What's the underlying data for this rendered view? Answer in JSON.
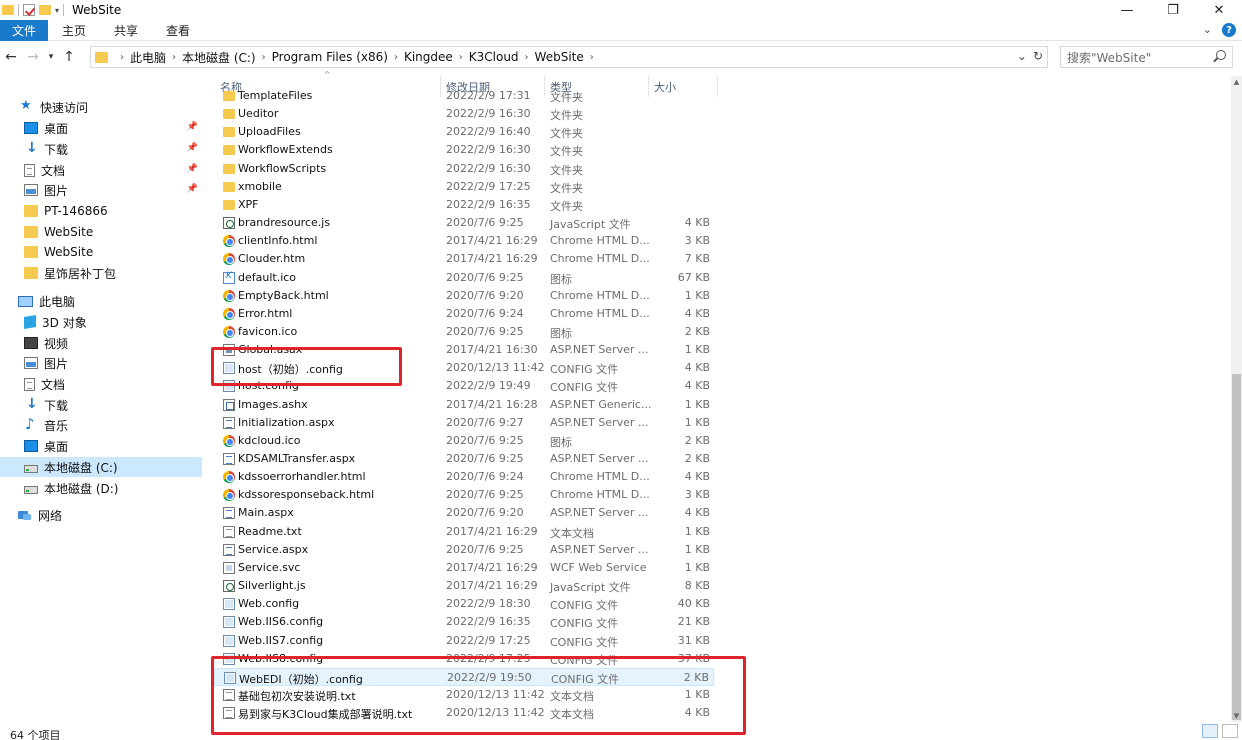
{
  "window": {
    "title": "WebSite",
    "minimize": "—",
    "maximize": "❐",
    "close": "✕"
  },
  "ribbon": {
    "tabs": [
      "文件",
      "主页",
      "共享",
      "查看"
    ],
    "expand": "⌄",
    "help": "?"
  },
  "address": {
    "crumbs": [
      "此电脑",
      "本地磁盘 (C:)",
      "Program Files (x86)",
      "Kingdee",
      "K3Cloud",
      "WebSite"
    ],
    "search_placeholder": "搜索\"WebSite\""
  },
  "sidebar": {
    "items": [
      {
        "label": "快速访问",
        "icon": "star-icon",
        "pinned": false
      },
      {
        "label": "桌面",
        "icon": "desktop-icon",
        "pinned": true
      },
      {
        "label": "下载",
        "icon": "download-icon",
        "pinned": true
      },
      {
        "label": "文档",
        "icon": "document-icon",
        "pinned": true
      },
      {
        "label": "图片",
        "icon": "picture-icon",
        "pinned": true
      },
      {
        "label": "PT-146866",
        "icon": "folder-icon",
        "pinned": false
      },
      {
        "label": "WebSite",
        "icon": "folder-icon",
        "pinned": false
      },
      {
        "label": "WebSite",
        "icon": "folder-icon",
        "pinned": false
      },
      {
        "label": "星饰居补丁包",
        "icon": "folder-icon",
        "pinned": false
      },
      {
        "label": "此电脑",
        "icon": "computer-icon",
        "pinned": false
      },
      {
        "label": "3D 对象",
        "icon": "3d-objects-icon",
        "pinned": false
      },
      {
        "label": "视频",
        "icon": "video-icon",
        "pinned": false
      },
      {
        "label": "图片",
        "icon": "picture-icon",
        "pinned": false
      },
      {
        "label": "文档",
        "icon": "document-icon",
        "pinned": false
      },
      {
        "label": "下载",
        "icon": "download-icon",
        "pinned": false
      },
      {
        "label": "音乐",
        "icon": "music-icon",
        "pinned": false
      },
      {
        "label": "桌面",
        "icon": "desktop-icon",
        "pinned": false
      },
      {
        "label": "本地磁盘 (C:)",
        "icon": "drive-icon",
        "pinned": false,
        "selected": true
      },
      {
        "label": "本地磁盘 (D:)",
        "icon": "drive-icon",
        "pinned": false
      },
      {
        "label": "网络",
        "icon": "network-icon",
        "pinned": false
      }
    ]
  },
  "columns": {
    "name": "名称",
    "date": "修改日期",
    "type": "类型",
    "size": "大小"
  },
  "files": [
    {
      "name": "TemplateFiles",
      "date": "2022/2/9 17:31",
      "type": "文件夹",
      "size": "",
      "icon": "folder"
    },
    {
      "name": "Ueditor",
      "date": "2022/2/9 16:30",
      "type": "文件夹",
      "size": "",
      "icon": "folder"
    },
    {
      "name": "UploadFiles",
      "date": "2022/2/9 16:40",
      "type": "文件夹",
      "size": "",
      "icon": "folder"
    },
    {
      "name": "WorkflowExtends",
      "date": "2022/2/9 16:30",
      "type": "文件夹",
      "size": "",
      "icon": "folder"
    },
    {
      "name": "WorkflowScripts",
      "date": "2022/2/9 16:30",
      "type": "文件夹",
      "size": "",
      "icon": "folder"
    },
    {
      "name": "xmobile",
      "date": "2022/2/9 17:25",
      "type": "文件夹",
      "size": "",
      "icon": "folder"
    },
    {
      "name": "XPF",
      "date": "2022/2/9 16:35",
      "type": "文件夹",
      "size": "",
      "icon": "folder"
    },
    {
      "name": "brandresource.js",
      "date": "2020/7/6 9:25",
      "type": "JavaScript 文件",
      "size": "4 KB",
      "icon": "js"
    },
    {
      "name": "clientInfo.html",
      "date": "2017/4/21 16:29",
      "type": "Chrome HTML D...",
      "size": "3 KB",
      "icon": "chrome"
    },
    {
      "name": "Clouder.htm",
      "date": "2017/4/21 16:29",
      "type": "Chrome HTML D...",
      "size": "7 KB",
      "icon": "chrome"
    },
    {
      "name": "default.ico",
      "date": "2020/7/6 9:25",
      "type": "图标",
      "size": "67 KB",
      "icon": "ico"
    },
    {
      "name": "EmptyBack.html",
      "date": "2020/7/6 9:20",
      "type": "Chrome HTML D...",
      "size": "1 KB",
      "icon": "chrome"
    },
    {
      "name": "Error.html",
      "date": "2020/7/6 9:24",
      "type": "Chrome HTML D...",
      "size": "4 KB",
      "icon": "chrome"
    },
    {
      "name": "favicon.ico",
      "date": "2020/7/6 9:25",
      "type": "图标",
      "size": "2 KB",
      "icon": "chrome"
    },
    {
      "name": "Global.asax",
      "date": "2017/4/21 16:30",
      "type": "ASP.NET Server ...",
      "size": "1 KB",
      "icon": "asax"
    },
    {
      "name": "host（初始）.config",
      "date": "2020/12/13 11:42",
      "type": "CONFIG 文件",
      "size": "4 KB",
      "icon": "config"
    },
    {
      "name": "host.config",
      "date": "2022/2/9 19:49",
      "type": "CONFIG 文件",
      "size": "4 KB",
      "icon": "config"
    },
    {
      "name": "Images.ashx",
      "date": "2017/4/21 16:28",
      "type": "ASP.NET Generic...",
      "size": "1 KB",
      "icon": "ashx"
    },
    {
      "name": "Initialization.aspx",
      "date": "2020/7/6 9:27",
      "type": "ASP.NET Server ...",
      "size": "1 KB",
      "icon": "aspx"
    },
    {
      "name": "kdcloud.ico",
      "date": "2020/7/6 9:25",
      "type": "图标",
      "size": "2 KB",
      "icon": "chrome"
    },
    {
      "name": "KDSAMLTransfer.aspx",
      "date": "2020/7/6 9:25",
      "type": "ASP.NET Server ...",
      "size": "2 KB",
      "icon": "aspx"
    },
    {
      "name": "kdssoerrorhandler.html",
      "date": "2020/7/6 9:24",
      "type": "Chrome HTML D...",
      "size": "4 KB",
      "icon": "chrome"
    },
    {
      "name": "kdssoresponseback.html",
      "date": "2020/7/6 9:25",
      "type": "Chrome HTML D...",
      "size": "3 KB",
      "icon": "chrome"
    },
    {
      "name": "Main.aspx",
      "date": "2020/7/6 9:20",
      "type": "ASP.NET Server ...",
      "size": "4 KB",
      "icon": "aspx"
    },
    {
      "name": "Readme.txt",
      "date": "2017/4/21 16:29",
      "type": "文本文档",
      "size": "1 KB",
      "icon": "txt"
    },
    {
      "name": "Service.aspx",
      "date": "2020/7/6 9:25",
      "type": "ASP.NET Server ...",
      "size": "1 KB",
      "icon": "aspx"
    },
    {
      "name": "Service.svc",
      "date": "2017/4/21 16:29",
      "type": "WCF Web Service",
      "size": "1 KB",
      "icon": "svc"
    },
    {
      "name": "Silverlight.js",
      "date": "2017/4/21 16:29",
      "type": "JavaScript 文件",
      "size": "8 KB",
      "icon": "js"
    },
    {
      "name": "Web.config",
      "date": "2022/2/9 18:30",
      "type": "CONFIG 文件",
      "size": "40 KB",
      "icon": "config"
    },
    {
      "name": "Web.IIS6.config",
      "date": "2022/2/9 16:35",
      "type": "CONFIG 文件",
      "size": "21 KB",
      "icon": "config"
    },
    {
      "name": "Web.IIS7.config",
      "date": "2022/2/9 17:25",
      "type": "CONFIG 文件",
      "size": "31 KB",
      "icon": "config"
    },
    {
      "name": "Web.IIS8.config",
      "date": "2022/2/9 17:25",
      "type": "CONFIG 文件",
      "size": "37 KB",
      "icon": "config"
    },
    {
      "name": "WebEDI（初始）.config",
      "date": "2022/2/9 19:50",
      "type": "CONFIG 文件",
      "size": "2 KB",
      "icon": "config",
      "hover": true
    },
    {
      "name": "基础包初次安装说明.txt",
      "date": "2020/12/13 11:42",
      "type": "文本文档",
      "size": "1 KB",
      "icon": "txt"
    },
    {
      "name": "易到家与K3Cloud集成部署说明.txt",
      "date": "2020/12/13 11:42",
      "type": "文本文档",
      "size": "4 KB",
      "icon": "txt"
    }
  ],
  "status": {
    "item_count": "64 个项目"
  }
}
